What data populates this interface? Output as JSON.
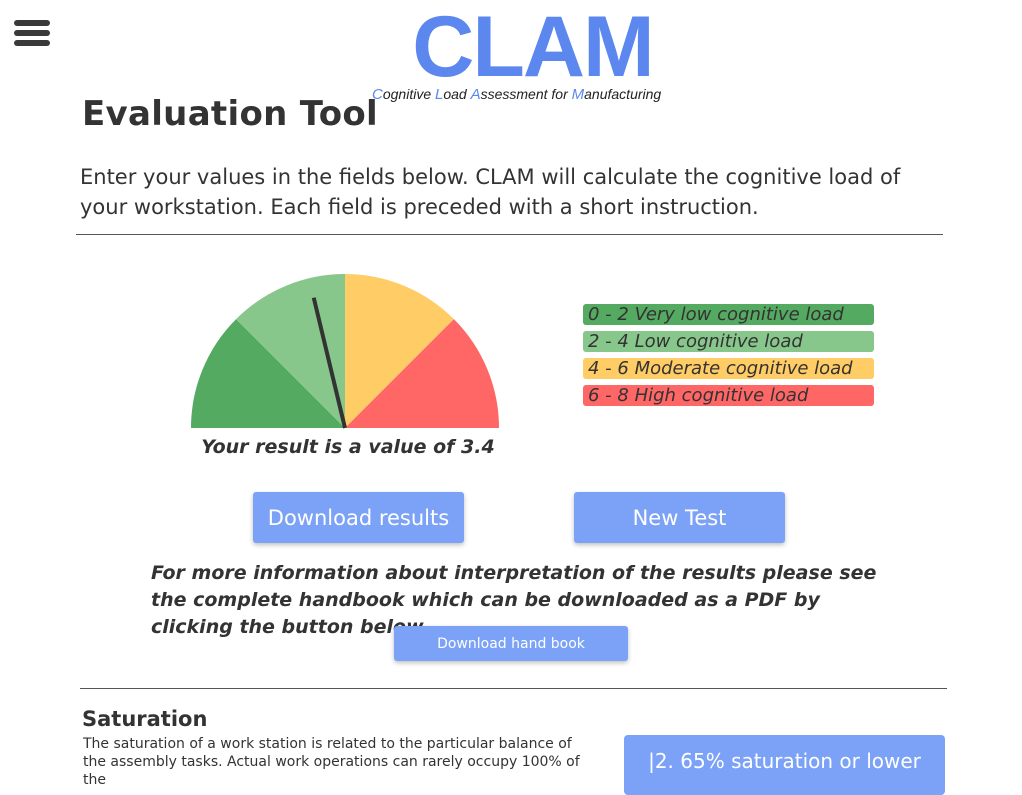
{
  "logo": {
    "main": "CLAM",
    "subtitle_parts": [
      {
        "text": "C",
        "hl": true
      },
      {
        "text": "ognitive ",
        "hl": false
      },
      {
        "text": "L",
        "hl": true
      },
      {
        "text": "oad ",
        "hl": false
      },
      {
        "text": "A",
        "hl": true
      },
      {
        "text": "ssessment for ",
        "hl": false
      },
      {
        "text": "M",
        "hl": true
      },
      {
        "text": "anufacturing",
        "hl": false
      }
    ]
  },
  "colors": {
    "brand": "#5b87ef",
    "button": "#7ba2f7",
    "very_low": "#55aa61",
    "low": "#88c78b",
    "moderate": "#ffcc66",
    "high": "#ff6666"
  },
  "menu": {
    "icon": "hamburger-menu-icon"
  },
  "page": {
    "title": "Evaluation Tool",
    "intro": "Enter your values in the fields below. CLAM will calculate the cognitive load of your workstation. Each field is preceded with a short instruction."
  },
  "gauge": {
    "min": 0,
    "max": 8,
    "value": 3.4,
    "segments": [
      {
        "from": 0,
        "to": 2,
        "color": "#55aa61"
      },
      {
        "from": 2,
        "to": 4,
        "color": "#88c78b"
      },
      {
        "from": 4,
        "to": 6,
        "color": "#ffcc66"
      },
      {
        "from": 6,
        "to": 8,
        "color": "#ff6666"
      }
    ]
  },
  "result": {
    "text": "Your result is a value of 3.4"
  },
  "legend": [
    {
      "label": "0 - 2 Very low cognitive load",
      "color": "#55aa61"
    },
    {
      "label": "2 - 4 Low cognitive load",
      "color": "#88c78b"
    },
    {
      "label": "4 - 6 Moderate cognitive load",
      "color": "#ffcc66"
    },
    {
      "label": "6 - 8 High cognitive load",
      "color": "#ff6666"
    }
  ],
  "actions": {
    "download": "Download results",
    "new_test": "New Test"
  },
  "info": {
    "text": "For more information about interpretation of the results please see the complete handbook which can be downloaded as a PDF by clicking the button below.",
    "handbook_button": "Download hand book"
  },
  "saturation": {
    "title": "Saturation",
    "text": "The saturation of a work station is related to the particular balance of the assembly tasks. Actual work operations can rarely occupy 100% of the",
    "option": "|2. 65% saturation or lower"
  }
}
